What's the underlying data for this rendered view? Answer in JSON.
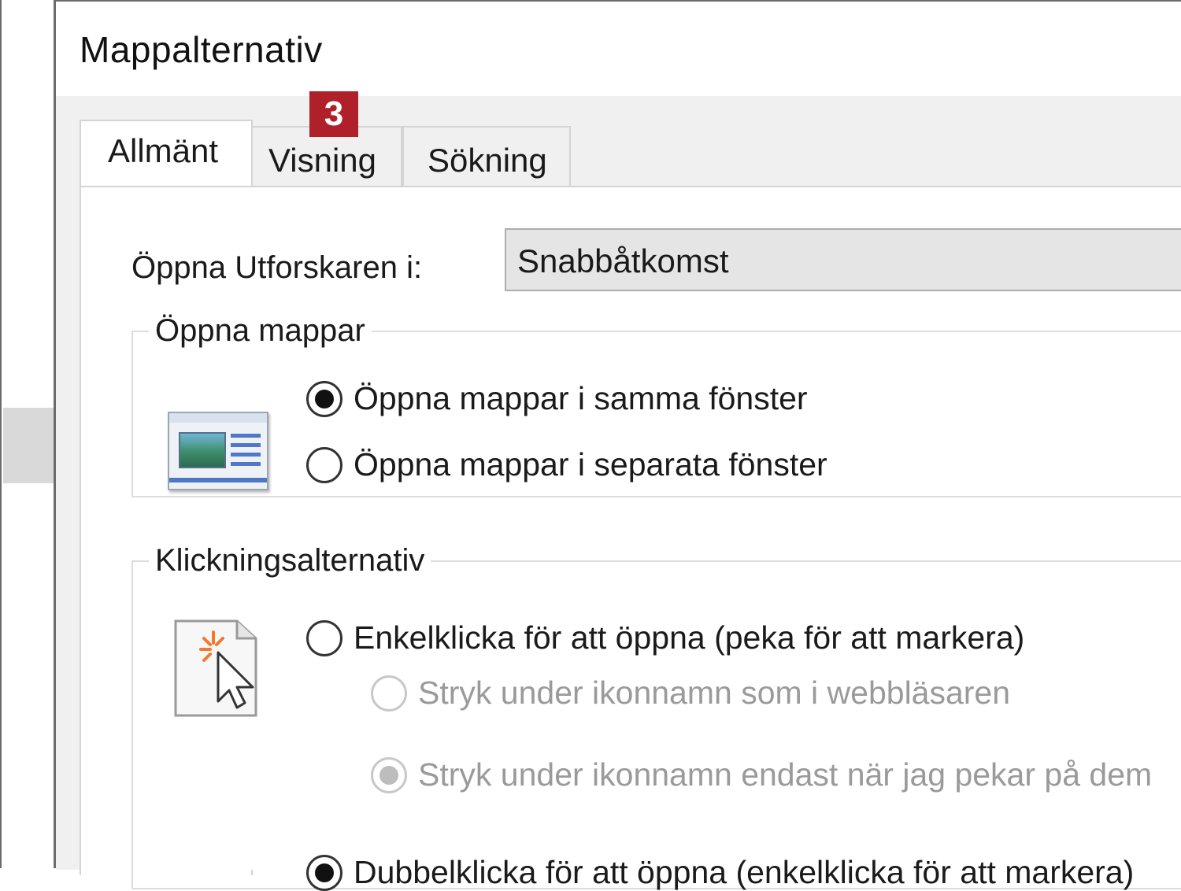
{
  "dialog": {
    "title": "Mappalternativ",
    "tabs": [
      {
        "label": "Allmänt",
        "active": true
      },
      {
        "label": "Visning",
        "active": false
      },
      {
        "label": "Sökning",
        "active": false
      }
    ],
    "badge": "3"
  },
  "general": {
    "open_explorer_label": "Öppna Utforskaren i:",
    "open_explorer_value": "Snabbåtkomst",
    "open_folders": {
      "legend": "Öppna mappar",
      "icon": "folder-window-icon",
      "options": [
        {
          "label": "Öppna mappar i samma fönster",
          "checked": true
        },
        {
          "label": "Öppna mappar i separata fönster",
          "checked": false
        }
      ]
    },
    "click_options": {
      "legend": "Klickningsalternativ",
      "icon": "click-pointer-icon",
      "single_click": {
        "label": "Enkelklicka för att öppna (peka för att markera)",
        "checked": false
      },
      "underline_always": {
        "label": "Stryk under ikonnamn som i webbläsaren",
        "checked": false,
        "disabled": true
      },
      "underline_hover": {
        "label": "Stryk under ikonnamn endast när jag pekar på dem",
        "checked": true,
        "disabled": true
      },
      "double_click": {
        "label": "Dubbelklicka för att öppna (enkelklicka för att markera)",
        "checked": true
      }
    }
  },
  "colors": {
    "badge": "#b0202a",
    "tab_strip": "#f0f0f0",
    "disabled_text": "#9a9a9a"
  }
}
